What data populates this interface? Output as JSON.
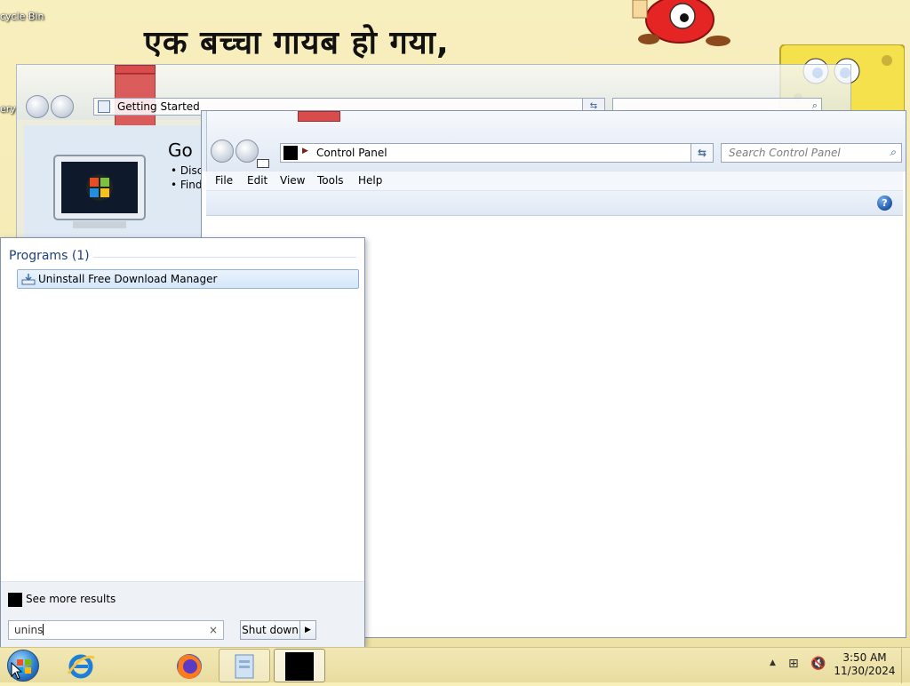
{
  "desktop": {
    "wallpaper_title": "एक बच्चा गायब हो गया,",
    "wallpaper_bottom_text": "",
    "recycle_bin_label": "cycle Bin",
    "library_label": "ery"
  },
  "getting_started_window": {
    "address_text": "Getting Started",
    "heading": "Go",
    "bullets": [
      "• Disc",
      "• Find"
    ]
  },
  "control_panel": {
    "address_text": "Control Panel",
    "search_placeholder": "Search Control Panel",
    "menu": [
      "File",
      "Edit",
      "View",
      "Tools",
      "Help"
    ],
    "help_icon": "help-icon"
  },
  "start_menu": {
    "programs_header": "Programs (1)",
    "results": [
      {
        "label": "Uninstall Free Download Manager",
        "icon": "uninstall-icon"
      }
    ],
    "see_more_label": "See more results",
    "search_value": "unins",
    "clear_symbol": "×",
    "shutdown_label": "Shut down"
  },
  "taskbar": {
    "items": [
      "start-orb",
      "internet-explorer-icon",
      "firefox-icon",
      "windows-explorer-icon",
      "active-app-icon"
    ],
    "clock_time": "3:50 AM",
    "clock_date": "11/30/2024"
  },
  "colors": {
    "wallpaper": "#f7eeb8",
    "selection": "#d4e6f9",
    "accent_blue": "#1e3f7a"
  }
}
